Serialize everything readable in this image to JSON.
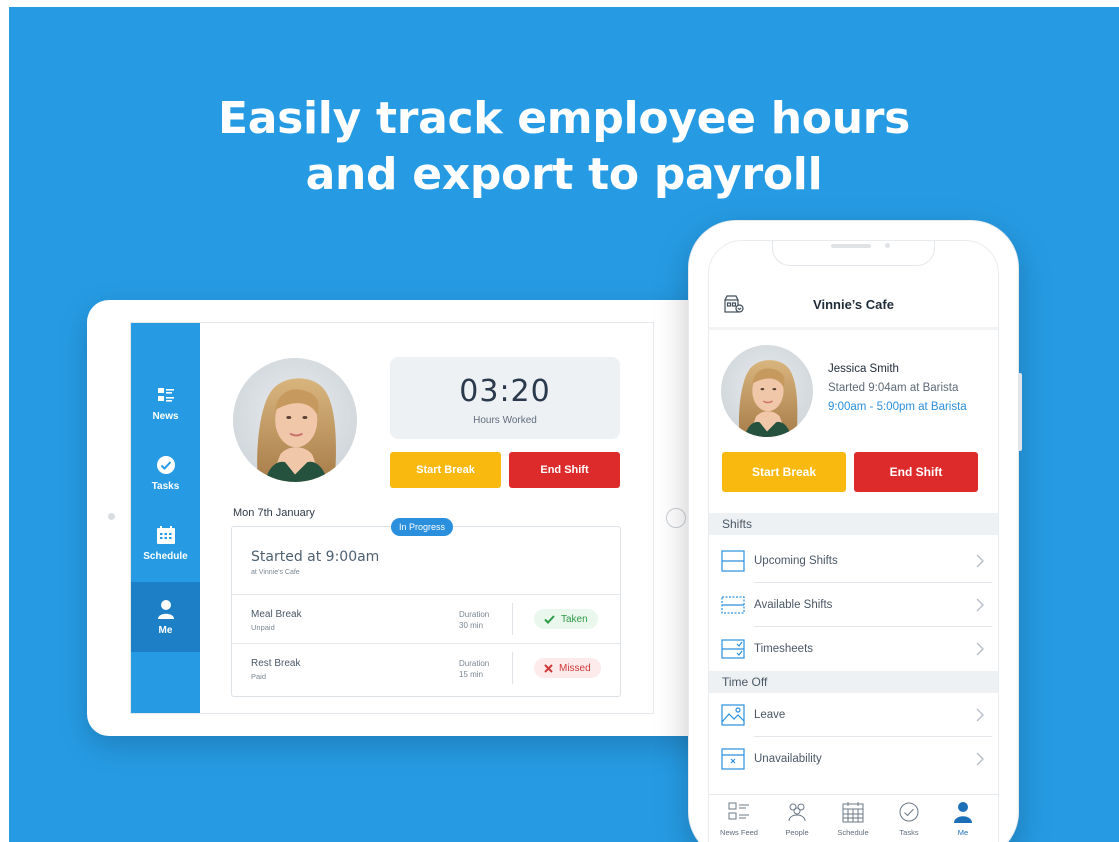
{
  "headline": {
    "line1": "Easily track employee hours",
    "line2": "and export to payroll"
  },
  "colors": {
    "background": "#269be4",
    "sidebar": "#269be4",
    "sidebar_active": "#1d7fc6",
    "yellow": "#f9b90f",
    "red": "#dd2a2a",
    "link_blue": "#2a8fdc"
  },
  "tablet": {
    "nav": [
      {
        "label": "News",
        "icon": "news-icon"
      },
      {
        "label": "Tasks",
        "icon": "check-circle-icon"
      },
      {
        "label": "Schedule",
        "icon": "calendar-icon"
      },
      {
        "label": "Me",
        "icon": "person-icon",
        "active": true
      }
    ],
    "hours_value": "03:20",
    "hours_label": "Hours Worked",
    "start_break": "Start Break",
    "end_shift": "End Shift",
    "date": "Mon 7th January",
    "status": "In Progress",
    "started": "Started at 9:00am",
    "started_location": "at Vinnie's Cafe",
    "breaks": [
      {
        "name": "Meal Break",
        "type": "Unpaid",
        "duration_label": "Duration",
        "duration": "30 min",
        "status": "Taken",
        "status_icon": "check-icon"
      },
      {
        "name": "Rest Break",
        "type": "Paid",
        "duration_label": "Duration",
        "duration": "15 min",
        "status": "Missed",
        "status_icon": "x-icon"
      }
    ]
  },
  "phone": {
    "title": "Vinnie’s Cafe",
    "employee_name": "Jessica Smith",
    "started": "Started 9:04am at Barista",
    "shift_time": "9:00am - 5:00pm at Barista",
    "start_break": "Start Break",
    "end_shift": "End Shift",
    "shifts_header": "Shifts",
    "shifts": [
      {
        "label": "Upcoming Shifts",
        "icon": "upcoming-shifts-icon"
      },
      {
        "label": "Available Shifts",
        "icon": "available-shifts-icon"
      },
      {
        "label": "Timesheets",
        "icon": "timesheets-icon"
      }
    ],
    "timeoff_header": "Time Off",
    "timeoff": [
      {
        "label": "Leave",
        "icon": "leave-icon"
      },
      {
        "label": "Unavailability",
        "icon": "unavailability-icon"
      }
    ],
    "tabs": [
      {
        "label": "News Feed",
        "icon": "news-feed-icon"
      },
      {
        "label": "People",
        "icon": "people-icon"
      },
      {
        "label": "Schedule",
        "icon": "calendar-icon"
      },
      {
        "label": "Tasks",
        "icon": "check-circle-icon"
      },
      {
        "label": "Me",
        "icon": "person-icon",
        "active": true
      }
    ]
  }
}
